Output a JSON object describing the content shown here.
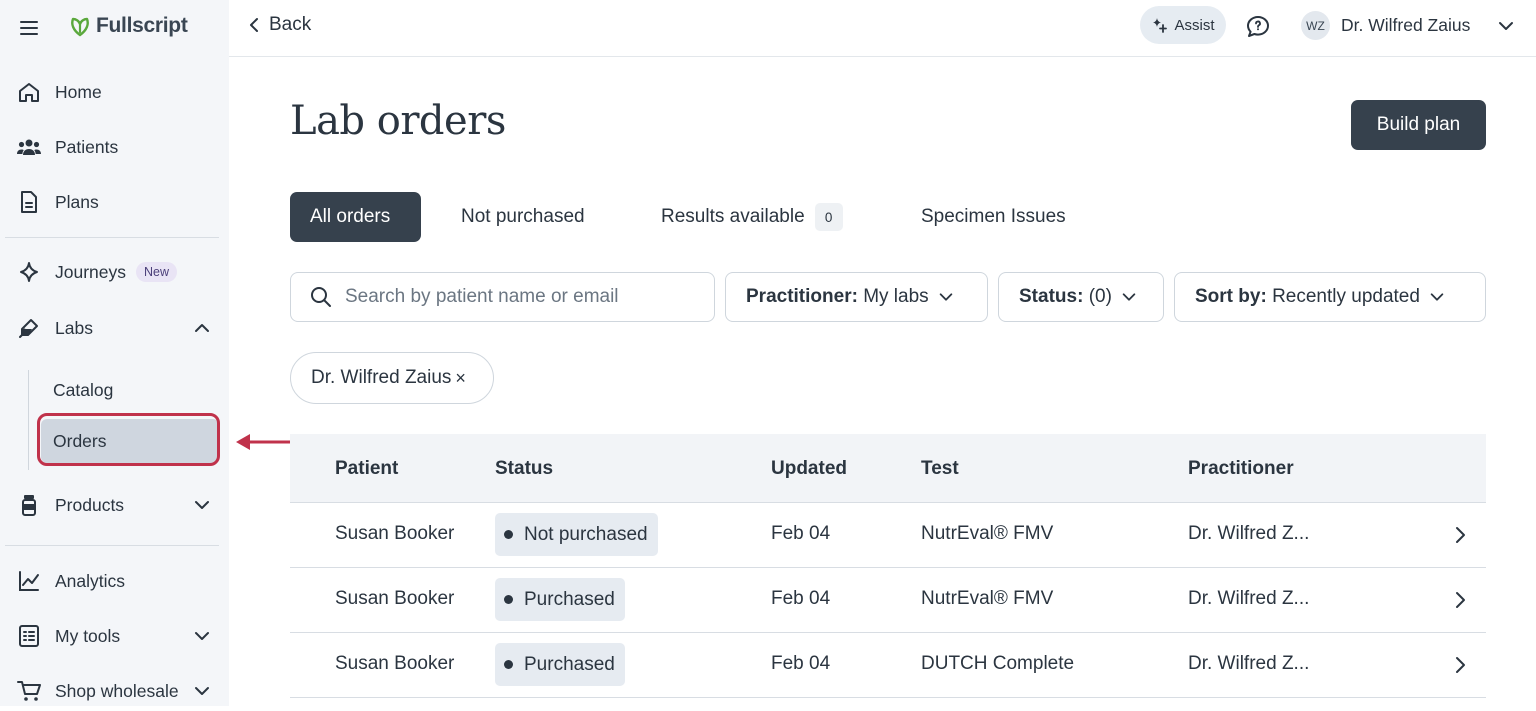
{
  "brand": {
    "name": "Fullscript"
  },
  "sidebar": {
    "items": [
      {
        "label": "Home",
        "icon": "home-icon"
      },
      {
        "label": "Patients",
        "icon": "users-icon"
      },
      {
        "label": "Plans",
        "icon": "document-icon"
      },
      {
        "label": "Journeys",
        "icon": "sparkle-icon",
        "badge": "New"
      },
      {
        "label": "Labs",
        "icon": "pipette-icon"
      },
      {
        "label": "Products",
        "icon": "bottle-icon"
      },
      {
        "label": "Analytics",
        "icon": "chart-icon"
      },
      {
        "label": "My tools",
        "icon": "checklist-icon"
      },
      {
        "label": "Shop wholesale",
        "icon": "cart-icon"
      }
    ],
    "labs_sub": [
      "Catalog",
      "Orders"
    ]
  },
  "topbar": {
    "back": "Back",
    "assist": "Assist",
    "avatar_initials": "WZ",
    "user_name": "Dr. Wilfred Zaius"
  },
  "main": {
    "title": "Lab orders",
    "build_plan": "Build plan",
    "tabs": [
      {
        "label": "All orders"
      },
      {
        "label": "Not purchased"
      },
      {
        "label": "Results available",
        "count": "0"
      },
      {
        "label": "Specimen Issues"
      }
    ],
    "search_placeholder": "Search by patient name or email",
    "filters": {
      "practitioner_key": "Practitioner:",
      "practitioner_value": "My labs",
      "status_key": "Status:",
      "status_value": "(0)",
      "sort_key": "Sort by:",
      "sort_value": "Recently updated"
    },
    "chip": {
      "label": "Dr. Wilfred Zaius",
      "remove": "×"
    },
    "table": {
      "headers": [
        "Patient",
        "Status",
        "Updated",
        "Test",
        "Practitioner"
      ],
      "rows": [
        {
          "patient": "Susan Booker",
          "status": "Not purchased",
          "updated": "Feb 04",
          "test": "NutrEval® FMV",
          "practitioner": "Dr. Wilfred Z..."
        },
        {
          "patient": "Susan Booker",
          "status": "Purchased",
          "updated": "Feb 04",
          "test": "NutrEval® FMV",
          "practitioner": "Dr. Wilfred Z..."
        },
        {
          "patient": "Susan Booker",
          "status": "Purchased",
          "updated": "Feb 04",
          "test": "DUTCH Complete",
          "practitioner": "Dr. Wilfred Z..."
        }
      ]
    }
  },
  "colors": {
    "accent_dark": "#36414d",
    "highlight": "#c0324b",
    "logo_green": "#5aa83c"
  }
}
